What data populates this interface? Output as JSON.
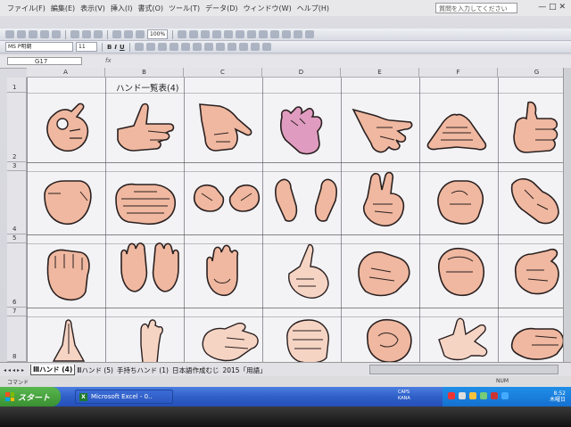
{
  "menu": {
    "items": [
      "ファイル(F)",
      "編集(E)",
      "表示(V)",
      "挿入(I)",
      "書式(O)",
      "ツール(T)",
      "データ(D)",
      "ウィンドウ(W)",
      "ヘルプ(H)"
    ],
    "help_placeholder": "質問を入力してください",
    "window_controls": "— □ ✕"
  },
  "toolbar": {
    "zoom": "100%",
    "font_name": "MS P明朝",
    "font_size": "11",
    "bold": "B",
    "italic": "I",
    "underline": "U"
  },
  "formula_bar": {
    "cell_ref": "G17",
    "fx": "fx"
  },
  "sheet": {
    "columns": [
      "A",
      "B",
      "C",
      "D",
      "E",
      "F",
      "G"
    ],
    "rows": [
      "1",
      "2",
      "3",
      "4",
      "5",
      "6",
      "7",
      "8"
    ],
    "title": "ハンド一覧表(4)"
  },
  "sheet_tabs": {
    "nav": "◂◂◂▸▸",
    "tabs": [
      "Ⅲハンド (4)",
      "Ⅲハンド (5)",
      "手持ちハンド (1)",
      "日本語作成むじ",
      "2015「用語」"
    ]
  },
  "status": {
    "left": "コマンド",
    "right": "NUM"
  },
  "taskbar": {
    "start": "スタート",
    "window": "Microsoft Excel - 0..",
    "ime": "CAPS\nKANA",
    "clock": "8:52\n木曜日"
  },
  "colors": {
    "skin": "#f0b8a0",
    "skin_light": "#f6d4c4",
    "skin_pink": "#e09cc0",
    "outline": "#2a2020",
    "taskbar": "#2f5fc8",
    "start": "#3a8f32"
  }
}
